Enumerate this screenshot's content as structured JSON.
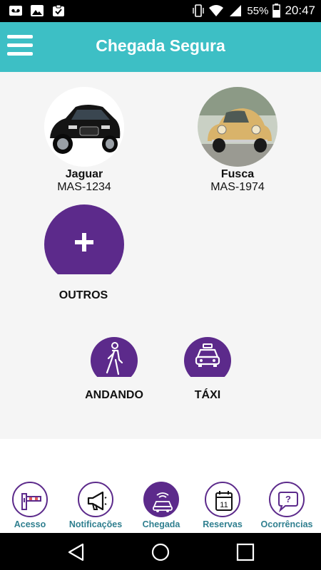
{
  "status_bar": {
    "battery": "55%",
    "time": "20:47"
  },
  "app_bar": {
    "title": "Chegada Segura"
  },
  "vehicles": [
    {
      "name": "Jaguar",
      "plate": "MAS-1234",
      "color": "#1a1a1a"
    },
    {
      "name": "Fusca",
      "plate": "MAS-1974",
      "color": "#d9b36a"
    }
  ],
  "add_other": {
    "label": "OUTROS"
  },
  "modes": [
    {
      "label": "ANDANDO",
      "icon": "walking-person-icon"
    },
    {
      "label": "TÁXI",
      "icon": "taxi-icon"
    }
  ],
  "bottom_nav": [
    {
      "label": "Acesso",
      "icon": "gate-barrier-icon",
      "active": false
    },
    {
      "label": "Notificações",
      "icon": "megaphone-icon",
      "active": false
    },
    {
      "label": "Chegada",
      "icon": "car-signal-icon",
      "active": true
    },
    {
      "label": "Reservas",
      "icon": "calendar-icon",
      "active": false
    },
    {
      "label": "Ocorrências",
      "icon": "question-bubble-icon",
      "active": false
    }
  ],
  "calendar_day": "11",
  "colors": {
    "app_bar": "#3dbfc5",
    "accent_purple": "#5c2a8b",
    "nav_label": "#2f7f8f",
    "main_bg": "#f5f5f5"
  }
}
